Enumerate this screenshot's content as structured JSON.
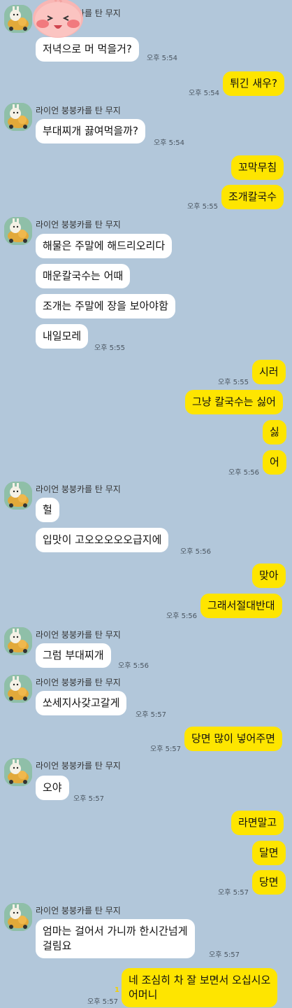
{
  "sender_name": "라이언 붕붕카를 탄 무지",
  "messages": {
    "m1": "저녁으로 머 먹을거?",
    "m2": "튀긴 새우?",
    "m3": "부대찌개 끓여먹을까?",
    "m4": "꼬막무침",
    "m5": "조개칼국수",
    "m6": "해물은 주말에 해드리오리다",
    "m7": "매운칼국수는 어때",
    "m8": "조개는 주말에 장을 보아야함",
    "m9": "내일모레",
    "m10": "시러",
    "m11": "그냥 칼국수는 싫어",
    "m12": "싫",
    "m13": "어",
    "m14": "헐",
    "m15": "입맛이 고오오오오오급지에",
    "m16": "맞아",
    "m17": "그래서절대반대",
    "m18": "그럼 부대찌개",
    "m19": "쏘세지사갖고갈게",
    "m20": "당면 많이 넣어주면",
    "m21": "오야",
    "m22": "라면말고",
    "m23": "달면",
    "m24": "당면",
    "m25_line1": "엄마는 걸어서 가니까 한시간넘게",
    "m25_line2": "걸림요",
    "m26_line1": "네 조심히 차 잘 보면서 오십시오",
    "m26_line2": "어머니"
  },
  "times": {
    "t554": "오후 5:54",
    "t555": "오후 5:55",
    "t556": "오후 5:56",
    "t557": "오후 5:57"
  },
  "unread_count": "1",
  "colors": {
    "background": "#b2c7da",
    "incoming_bubble": "#ffffff",
    "outgoing_bubble": "#fee500"
  },
  "icons": {
    "avatar": "muzi-riding-ryan-car-avatar",
    "sticker": "apeach-face-icon"
  }
}
